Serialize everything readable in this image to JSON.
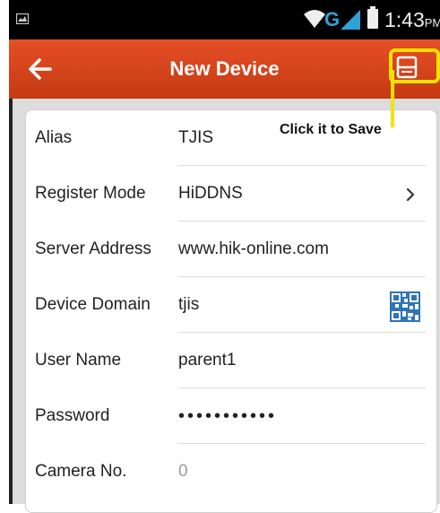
{
  "status_bar": {
    "network": "G",
    "time": "1:43",
    "ampm": "PM",
    "icons": [
      "notification-icon",
      "wifi-icon",
      "signal-icon",
      "battery-icon"
    ]
  },
  "header": {
    "title": "New Device",
    "back_icon": "arrow-left-icon",
    "save_icon": "save-icon",
    "color": "#d8431a"
  },
  "annotation": {
    "text": "Click it to Save",
    "color": "#f4e100"
  },
  "form": {
    "alias": {
      "label": "Alias",
      "value": "TJIS"
    },
    "register_mode": {
      "label": "Register Mode",
      "value": "HiDDNS"
    },
    "server_address": {
      "label": "Server Address",
      "value": "www.hik-online.com"
    },
    "device_domain": {
      "label": "Device Domain",
      "value": "tjis"
    },
    "user_name": {
      "label": "User Name",
      "value": "parent1"
    },
    "password": {
      "label": "Password",
      "value": "•••••••••••"
    },
    "camera_no": {
      "label": "Camera No.",
      "value": "0"
    }
  }
}
